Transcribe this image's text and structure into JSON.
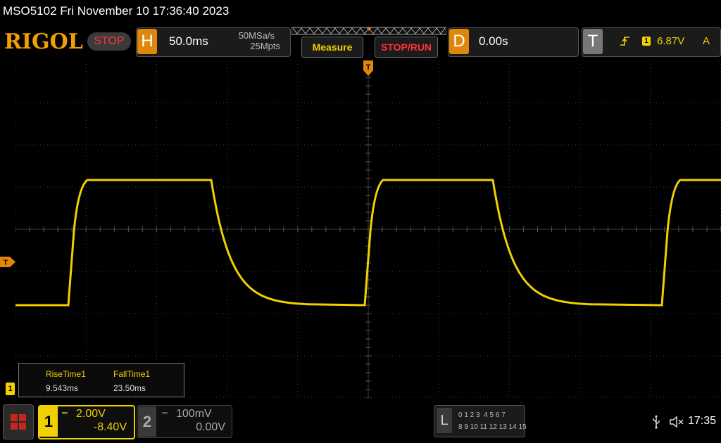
{
  "title_bar": {
    "text": "MSO5102  Fri November 10 17:36:40 2023"
  },
  "toolbar": {
    "logo": "RIGOL",
    "run_state": "STOP",
    "horizontal": {
      "letter": "H",
      "timebase": "50.0ms",
      "sample_rate": "50MSa/s",
      "memory_depth": "25Mpts"
    },
    "measure_label": "Measure",
    "stop_run_label": "STOP/RUN",
    "delay": {
      "letter": "D",
      "value": "0.00s"
    },
    "trigger": {
      "letter": "T",
      "source": "1",
      "level": "6.87V",
      "mode": "A",
      "slope_icon": "rising-edge-icon"
    }
  },
  "markers": {
    "trigger_position": "T",
    "trigger_level": "T",
    "ch1_ground": "1"
  },
  "measurements": {
    "rise_label": "RiseTime1",
    "rise_value": "9.543ms",
    "fall_label": "FallTime1",
    "fall_value": "23.50ms"
  },
  "channels": {
    "ch1": {
      "number": "1",
      "scale": "2.00V",
      "offset": "-8.40V",
      "color": "#f0d000",
      "active": true
    },
    "ch2": {
      "number": "2",
      "scale": "100mV",
      "offset": "0.00V",
      "color": "#aaaaaa",
      "active": false
    }
  },
  "logic_analyzer": {
    "letter": "L",
    "row1": "0 1 2 3  4 5 6 7",
    "row2": "8 9 10 11 12 13 14 15"
  },
  "status": {
    "clock": "17:35",
    "usb_icon": "usb-icon",
    "speaker_icon": "speaker-muted-icon"
  },
  "colors": {
    "ch1": "#f0d000",
    "accent": "#e0860a",
    "stop": "#ff3333",
    "grid": "#3c3c3c"
  },
  "waveform": {
    "channel": "1",
    "shape": "square with exponential fall",
    "rise_time": "9.543ms",
    "fall_time": "23.50ms",
    "grid_divisions": {
      "horizontal": 10,
      "vertical": 8
    }
  }
}
